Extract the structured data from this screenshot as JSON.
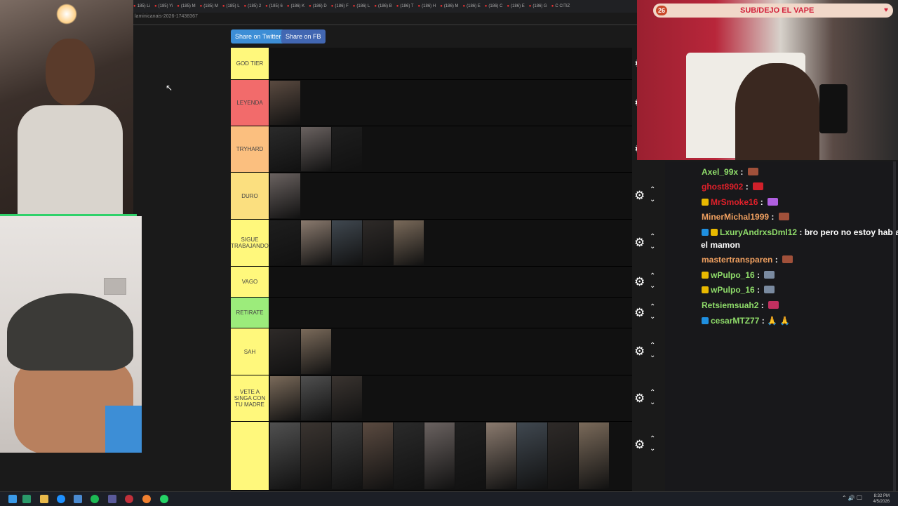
{
  "browser": {
    "tabs": [
      "185) Li",
      "(185) Yi",
      "(185) M",
      "(185) M",
      "(185) L",
      "(185) 2",
      "(185) 6",
      "(186) K",
      "(186) D",
      "(186) F",
      "(186) L",
      "(186) B",
      "(186) T",
      "(186) H",
      "(186) M",
      "(186) E",
      "(186) C",
      "(186) E",
      "(186) G",
      "C CITIZ"
    ],
    "url": "laminicanais-2026-17438367"
  },
  "share": {
    "twitter": "Share on Twitter",
    "facebook": "Share on FB"
  },
  "tiers": [
    {
      "label": "GOD TIER",
      "color": "#fff87c"
    },
    {
      "label": "LEYENDA",
      "color": "#f26b6b"
    },
    {
      "label": "TRYHARD",
      "color": "#fbbf7f"
    },
    {
      "label": "DURO",
      "color": "#fbdf7f"
    },
    {
      "label": "SIGUE TRABAJANDO",
      "color": "#fff87c"
    },
    {
      "label": "VAGO",
      "color": "#fff87c"
    },
    {
      "label": "RETIRATE",
      "color": "#9cec7b"
    },
    {
      "label": "SAH",
      "color": "#fff87c"
    },
    {
      "label": "VETE A SINGA CON TU MADRE",
      "color": "#fff87c"
    },
    {
      "label": "",
      "color": "#fff87c"
    }
  ],
  "streamer": {
    "sub_count": "26",
    "banner": "SUB/DEJO EL VAPE"
  },
  "chat": [
    {
      "user": "Axel_99x",
      "color": "#8fdc6a",
      "text": "",
      "emote": "#a0503a"
    },
    {
      "user": "ghost8902",
      "color": "#e0202a",
      "text": "",
      "emote": "#d0202a"
    },
    {
      "user": "MrSmoke16",
      "color": "#e0202a",
      "text": "",
      "emote": "#b060e0",
      "badge": "#e8b800"
    },
    {
      "user": "MinerMichal1999",
      "color": "#f0a060",
      "text": "",
      "emote": "#a0503a"
    },
    {
      "user": "LxuryAndrxsDml12",
      "color": "#8fdc6a",
      "text": "bro pero no estoy hablando",
      "badge": "#1f8fe0",
      "badge2": "#e8b800"
    },
    {
      "user": "",
      "color": "#fff",
      "text": "el mamon"
    },
    {
      "user": "mastertransparen",
      "color": "#f0a060",
      "text": "",
      "emote": "#a0503a"
    },
    {
      "user": "wPulpo_16",
      "color": "#8fdc6a",
      "text": "",
      "emote": "#7a8aa0",
      "badge": "#e8b800"
    },
    {
      "user": "wPulpo_16",
      "color": "#8fdc6a",
      "text": "",
      "emote": "#7a8aa0",
      "badge": "#e8b800"
    },
    {
      "user": "Retsiemsuah2",
      "color": "#8fdc6a",
      "text": "",
      "emote": "#c03060"
    },
    {
      "user": "cesarMTZ77",
      "color": "#8fdc6a",
      "text": "🙏 🙏",
      "badge": "#1f8fe0"
    }
  ],
  "taskbar": {
    "time": "8:32 PM",
    "date": "4/5/2026"
  }
}
